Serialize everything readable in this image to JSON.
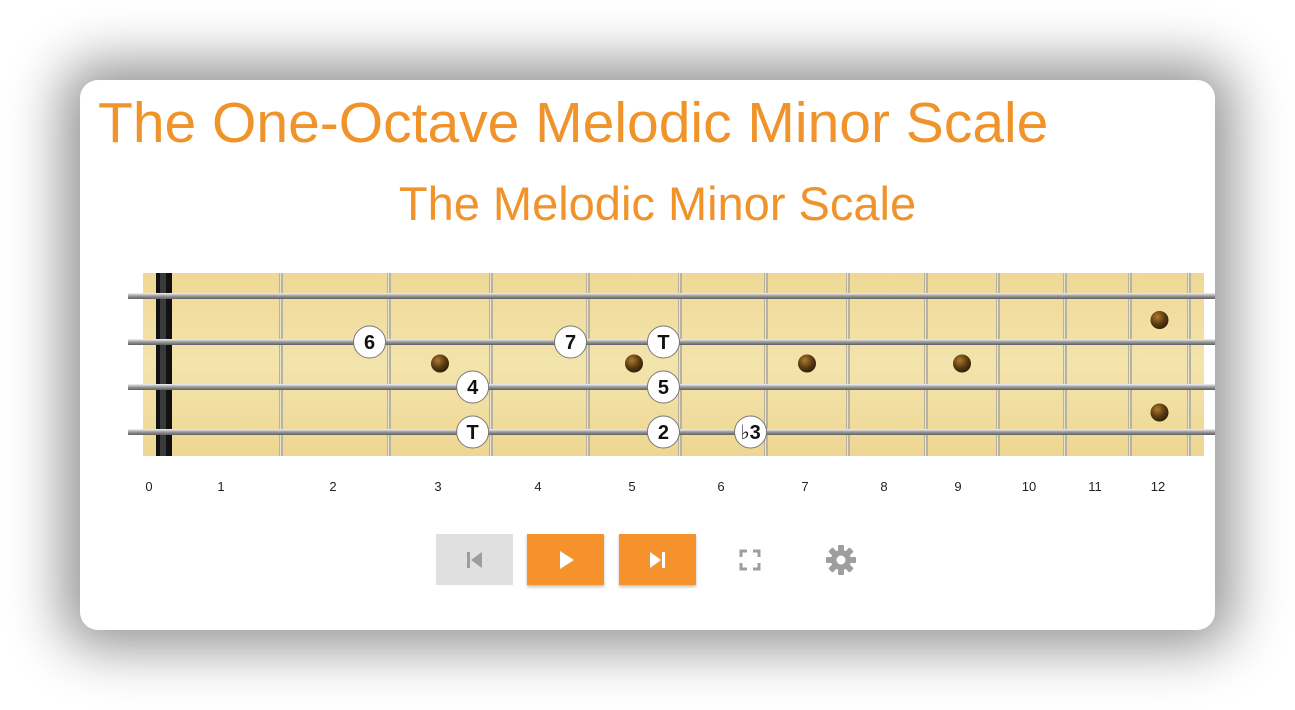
{
  "page": {
    "title": "The One-Octave Melodic Minor Scale"
  },
  "diagram": {
    "title": "The Melodic Minor Scale",
    "fret_numbers": [
      "0",
      "1",
      "2",
      "3",
      "4",
      "5",
      "6",
      "7",
      "8",
      "9",
      "10",
      "11",
      "12"
    ],
    "strings": 4,
    "inlay_frets": [
      3,
      5,
      7,
      9
    ],
    "double_inlay_fret": 12,
    "notes": [
      {
        "label": "6",
        "string": 2,
        "fret": 2
      },
      {
        "label": "7",
        "string": 2,
        "fret": 4
      },
      {
        "label": "T",
        "string": 2,
        "fret": 5
      },
      {
        "label": "4",
        "string": 3,
        "fret": 3
      },
      {
        "label": "5",
        "string": 3,
        "fret": 5
      },
      {
        "label": "T",
        "string": 4,
        "fret": 3
      },
      {
        "label": "2",
        "string": 4,
        "fret": 5
      },
      {
        "label": "♭3",
        "string": 4,
        "fret": 6
      }
    ]
  },
  "controls": {
    "previous": {
      "icon": "skip-previous-icon",
      "disabled": true
    },
    "play": {
      "icon": "play-icon"
    },
    "next": {
      "icon": "skip-next-icon"
    },
    "fullscreen": {
      "icon": "fullscreen-icon"
    },
    "settings": {
      "icon": "gear-icon"
    }
  },
  "colors": {
    "title": "#f0932b",
    "button_primary": "#f5922b",
    "button_disabled": "#e0e0e0",
    "fretboard": "#f1df9f",
    "note_circle": "#ffffff",
    "inlay": "#5a3b12"
  }
}
